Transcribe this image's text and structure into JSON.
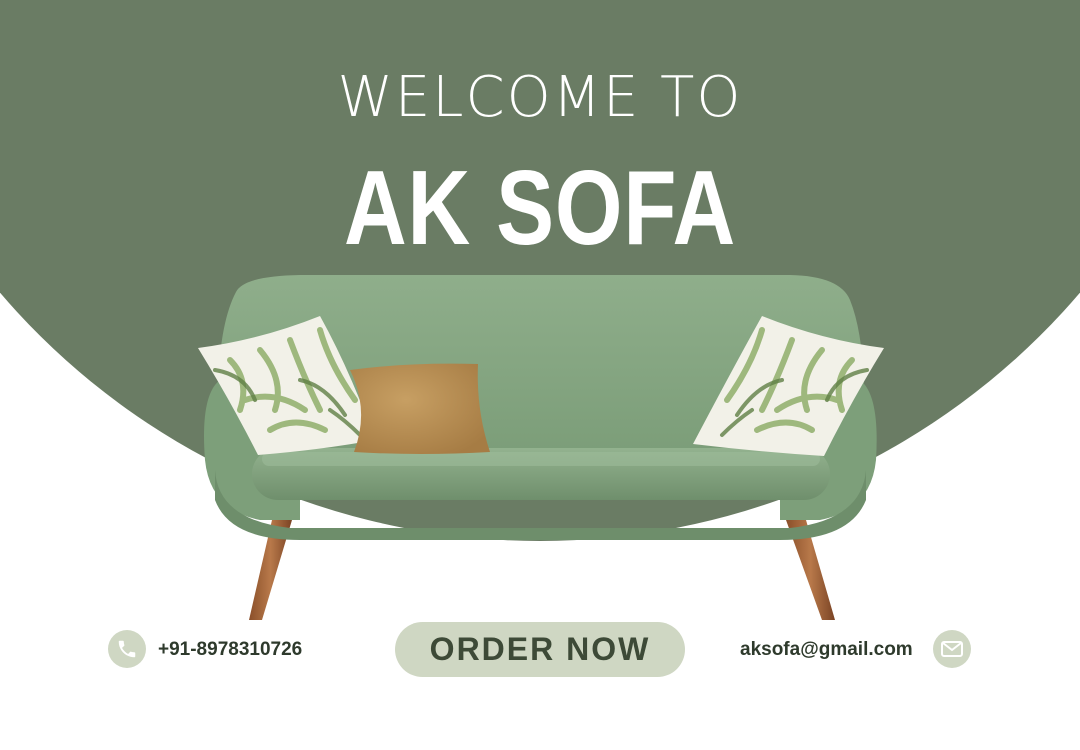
{
  "heading": {
    "welcome": "WELCOME TO",
    "brand": "AK SOFA"
  },
  "contact": {
    "phone": "+91-8978310726",
    "email": "aksofa@gmail.com"
  },
  "cta": {
    "label": "ORDER NOW"
  },
  "icons": {
    "phone": "phone-icon",
    "mail": "mail-icon"
  },
  "colors": {
    "background_green": "#6a7c64",
    "accent_light": "#cfd7c3",
    "text_dark": "#2e3a2c",
    "sofa_green": "#86a583",
    "pillow_tan": "#b38a50"
  }
}
